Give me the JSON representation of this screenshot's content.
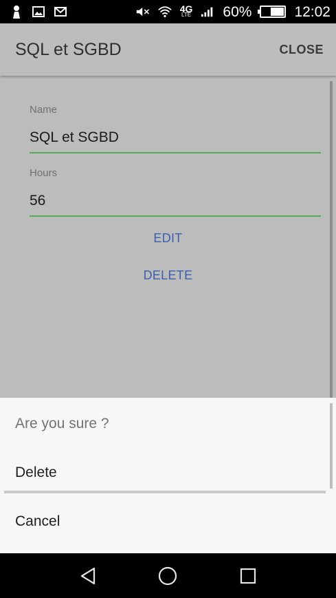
{
  "status_bar": {
    "network": "4G",
    "network_sub": "LTE",
    "battery_percent": "60%",
    "battery_level": 0.6,
    "time": "12:02",
    "icons": [
      "person-icon",
      "image-icon",
      "mail-icon",
      "mute-icon",
      "wifi-icon",
      "signal-icon",
      "battery-icon"
    ]
  },
  "app_bar": {
    "title": "SQL et SGBD",
    "close_label": "CLOSE"
  },
  "form": {
    "name_label": "Name",
    "name_value": "SQL et SGBD",
    "hours_label": "Hours",
    "hours_value": "56",
    "edit_label": "EDIT",
    "delete_label": "DELETE",
    "accent_color": "#4caf50",
    "button_color": "#3a5fb0"
  },
  "sheet": {
    "title": "Are you sure ?",
    "items": [
      "Delete",
      "Cancel"
    ]
  },
  "nav_bar": {
    "icons": [
      "back-icon",
      "home-icon",
      "recents-icon"
    ]
  }
}
